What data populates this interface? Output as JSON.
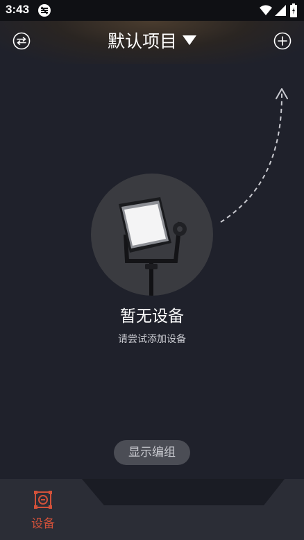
{
  "status_bar": {
    "time": "3:43",
    "icons": [
      "app-notification-icon",
      "wifi-icon",
      "cell-signal-icon",
      "battery-icon"
    ]
  },
  "header": {
    "title": "默认项目",
    "left_icon": "swap-arrows-icon",
    "right_icon": "plus-circle-icon",
    "title_icon": "caret-down-icon"
  },
  "empty_state": {
    "title": "暂无设备",
    "subtitle": "请尝试添加设备",
    "image": "studio-light-image"
  },
  "group_button": {
    "label": "显示编组"
  },
  "bottom_nav": {
    "tabs": [
      {
        "label": "设备",
        "icon": "device-frame-icon",
        "active": true
      }
    ]
  },
  "colors": {
    "background": "#1f212b",
    "accent": "#d2513a",
    "pill": "#4b4d55"
  }
}
